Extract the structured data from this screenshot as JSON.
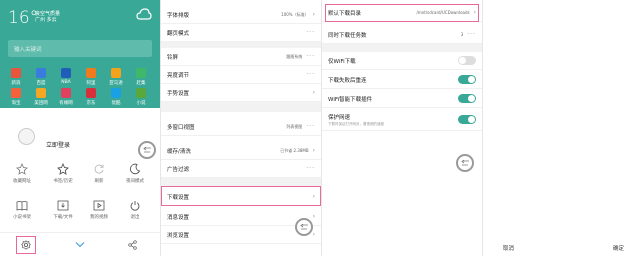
{
  "weather": {
    "temp": "16°",
    "air": "良空气质量",
    "city": "广州 多云"
  },
  "search": {
    "placeholder": "输入关键词"
  },
  "grid": [
    {
      "label": "新浪",
      "color": "#e8543d"
    },
    {
      "label": "百度",
      "color": "#3a7be0"
    },
    {
      "label": "NBA",
      "color": "#1f5db8"
    },
    {
      "label": "阿里",
      "color": "#f07a1e"
    },
    {
      "label": "亚马逊",
      "color": "#f2a31b"
    },
    {
      "label": "赶集",
      "color": "#3fb86a"
    },
    {
      "label": "淘宝",
      "color": "#f4613a"
    },
    {
      "label": "美团网",
      "color": "#f5a623"
    },
    {
      "label": "有缘网",
      "color": "#e0415c"
    },
    {
      "label": "京东",
      "color": "#d6303a"
    },
    {
      "label": "优酷",
      "color": "#1aa0e4"
    },
    {
      "label": "小说",
      "color": "#5aa83b"
    }
  ],
  "menu": {
    "login": "立即登录",
    "row1": [
      "收藏网址",
      "书签/历史",
      "刷新",
      "夜间模式"
    ],
    "row2": [
      "小说书架",
      "下载/文件",
      "我的视频",
      "退出"
    ]
  },
  "settings": {
    "items": [
      {
        "label": "字体排版",
        "value": "100%（标准）",
        "kind": "chev"
      },
      {
        "label": "翻页模式",
        "value": "",
        "kind": "dots"
      },
      {
        "label": "铃屏",
        "value": "跟随系统",
        "kind": "dots"
      },
      {
        "label": "亮度调节",
        "value": "",
        "kind": "dots"
      },
      {
        "label": "手势设置",
        "value": "",
        "kind": "chev"
      },
      {
        "label": "多窗口视图",
        "value": "列表视图",
        "kind": "dots"
      },
      {
        "label": "缓存/清洗",
        "value": "已节省 2.38MB",
        "kind": "chev"
      },
      {
        "label": "广告过滤",
        "value": "",
        "kind": "dots"
      },
      {
        "label": "下载设置",
        "value": "",
        "kind": "chev"
      },
      {
        "label": "消息设置",
        "value": "",
        "kind": "chev"
      },
      {
        "label": "浏览设置",
        "value": "",
        "kind": "chev"
      }
    ]
  },
  "download": {
    "dir_label": "默认下载目录",
    "dir_value": "/mnt/sdcard/UCDownloads",
    "concurrent_label": "同时下载任务数",
    "concurrent_value": "3",
    "wifi_only": "仅WiFi下载",
    "resume": "下载失败后重连",
    "plugin": "WiFi智能下载插件",
    "protect": "保护网速",
    "protect_sub": "下载时保证打开网页，看视频的速度"
  },
  "dialog": {
    "cancel": "取消",
    "ok": "确定"
  },
  "colors": {
    "accent": "#3aa896",
    "highlight": "#e86a9a"
  }
}
